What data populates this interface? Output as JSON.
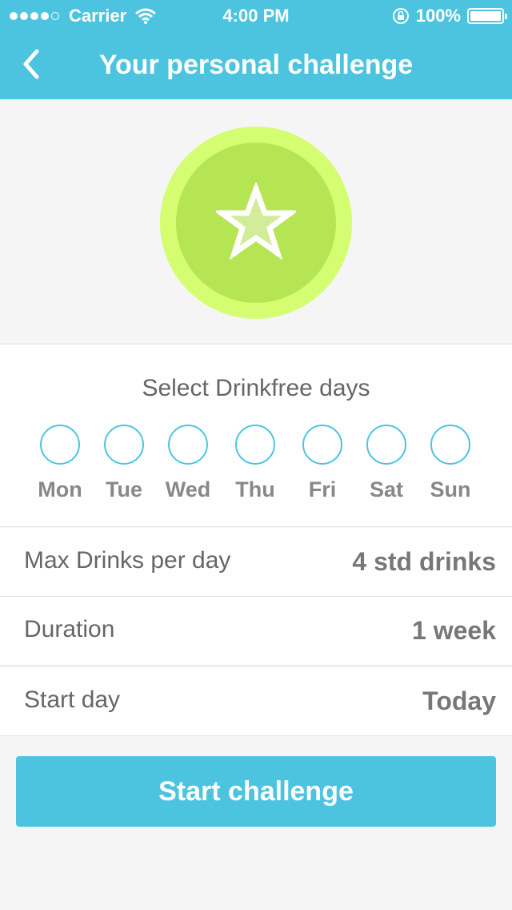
{
  "status_bar": {
    "carrier": "Carrier",
    "time": "4:00 PM",
    "battery": "100%"
  },
  "nav": {
    "title": "Your personal challenge"
  },
  "days_section": {
    "title": "Select Drinkfree days",
    "days": [
      {
        "label": "Mon"
      },
      {
        "label": "Tue"
      },
      {
        "label": "Wed"
      },
      {
        "label": "Thu"
      },
      {
        "label": "Fri"
      },
      {
        "label": "Sat"
      },
      {
        "label": "Sun"
      }
    ]
  },
  "settings": [
    {
      "label": "Max Drinks per day",
      "value": "4 std drinks"
    },
    {
      "label": "Duration",
      "value": "1 week"
    },
    {
      "label": "Start day",
      "value": "Today"
    }
  ],
  "cta": {
    "label": "Start challenge"
  },
  "colors": {
    "accent": "#4dc4df",
    "badge_outer": "#d4fd72",
    "badge_inner": "#b6e554",
    "star_fill": "#d2ec9a"
  },
  "icons": [
    "back-chevron-icon",
    "wifi-icon",
    "rotation-lock-icon",
    "battery-icon",
    "star-icon"
  ]
}
